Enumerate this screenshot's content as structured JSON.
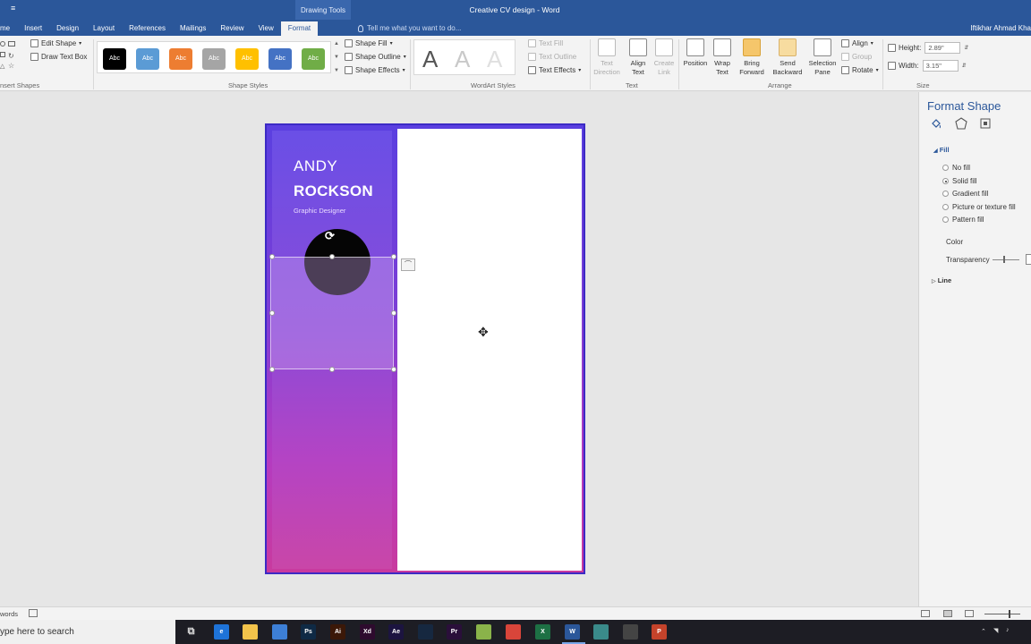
{
  "titlebar": {
    "qat": "≡",
    "contextual_group": "Drawing Tools",
    "doc_title": "Creative CV design - Word",
    "user": "Iftikhar Ahmad Kha",
    "tell_me": "Tell me what you want to do..."
  },
  "tabs": [
    {
      "label": "me"
    },
    {
      "label": "Insert"
    },
    {
      "label": "Design"
    },
    {
      "label": "Layout"
    },
    {
      "label": "References"
    },
    {
      "label": "Mailings"
    },
    {
      "label": "Review"
    },
    {
      "label": "View"
    },
    {
      "label": "Format"
    }
  ],
  "ribbon": {
    "insert_shapes": {
      "label": "nsert Shapes",
      "edit_shape": "Edit Shape",
      "draw_text_box": "Draw Text Box"
    },
    "shape_styles": {
      "label": "Shape Styles",
      "chips": [
        {
          "text": "Abc",
          "color": "#000000"
        },
        {
          "text": "Abc",
          "color": "#5b9bd5"
        },
        {
          "text": "Abc",
          "color": "#ed7d31"
        },
        {
          "text": "Abc",
          "color": "#a5a5a5"
        },
        {
          "text": "Abc",
          "color": "#ffc000"
        },
        {
          "text": "Abc",
          "color": "#4472c4"
        },
        {
          "text": "Abc",
          "color": "#70ad47"
        }
      ],
      "shape_fill": "Shape Fill",
      "shape_outline": "Shape Outline",
      "shape_effects": "Shape Effects"
    },
    "wordart": {
      "label": "WordArt Styles",
      "letters": [
        "A",
        "A",
        "A"
      ],
      "text_fill": "Text Fill",
      "text_outline": "Text Outline",
      "text_effects": "Text Effects"
    },
    "text_group": {
      "label": "Text",
      "direction": [
        "Text",
        "Direction"
      ],
      "align": [
        "Align",
        "Text"
      ],
      "link": [
        "Create",
        "Link"
      ]
    },
    "arrange": {
      "label": "Arrange",
      "position": "Position",
      "wrap": [
        "Wrap",
        "Text"
      ],
      "bring": [
        "Bring",
        "Forward"
      ],
      "send": [
        "Send",
        "Backward"
      ],
      "selection": [
        "Selection",
        "Pane"
      ],
      "align": "Align",
      "group": "Group",
      "rotate": "Rotate"
    },
    "size": {
      "label": "Size",
      "height_label": "Height:",
      "height_value": "2.89\"",
      "width_label": "Width:",
      "width_value": "3.15\""
    }
  },
  "document": {
    "first_name": "ANDY",
    "last_name": "ROCKSON",
    "role": "Graphic Designer"
  },
  "format_pane": {
    "title": "Format Shape",
    "fill_header": "Fill",
    "options": [
      {
        "label": "No fill",
        "selected": false
      },
      {
        "label": "Solid fill",
        "selected": true
      },
      {
        "label": "Gradient fill",
        "selected": false
      },
      {
        "label": "Picture or texture fill",
        "selected": false
      },
      {
        "label": "Pattern fill",
        "selected": false
      }
    ],
    "color_label": "Color",
    "transparency_label": "Transparency",
    "line_header": "Line"
  },
  "statusbar": {
    "words": "words"
  },
  "taskbar": {
    "search": "ype here to search",
    "apps": [
      {
        "icon": "edge-icon",
        "text": "e",
        "color": "#1e73d8"
      },
      {
        "icon": "file-explorer-icon",
        "text": "",
        "color": "#f2c34b"
      },
      {
        "icon": "store-icon",
        "text": "",
        "color": "#3d7fd6"
      },
      {
        "icon": "photoshop-icon",
        "text": "Ps",
        "color": "#0f2a45"
      },
      {
        "icon": "illustrator-icon",
        "text": "Ai",
        "color": "#3b1808"
      },
      {
        "icon": "xd-icon",
        "text": "Xd",
        "color": "#2e0b2e"
      },
      {
        "icon": "after-effects-icon",
        "text": "Ae",
        "color": "#1c1440"
      },
      {
        "icon": "media-encoder-icon",
        "text": "",
        "color": "#162840"
      },
      {
        "icon": "premiere-icon",
        "text": "Pr",
        "color": "#2a0f3a"
      },
      {
        "icon": "android-icon",
        "text": "",
        "color": "#8ab34a"
      },
      {
        "icon": "chrome-icon",
        "text": "",
        "color": "#d9453a"
      },
      {
        "icon": "excel-icon",
        "text": "X",
        "color": "#1d7044"
      },
      {
        "icon": "word-icon",
        "text": "W",
        "color": "#2b579a"
      },
      {
        "icon": "app-icon",
        "text": "",
        "color": "#3a8a8a"
      },
      {
        "icon": "recorder-icon",
        "text": "",
        "color": "#444444"
      },
      {
        "icon": "powerpoint-icon",
        "text": "P",
        "color": "#c4432b"
      }
    ]
  }
}
